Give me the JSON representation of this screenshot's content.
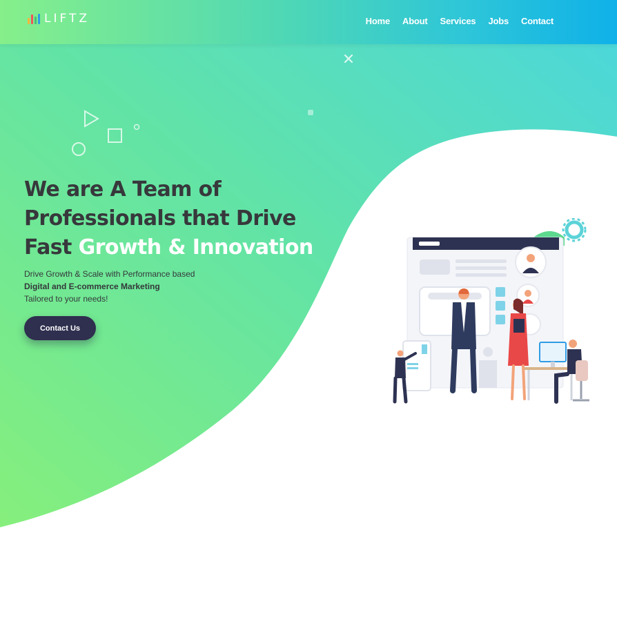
{
  "brand": {
    "name": "LIFTZ",
    "logo_icon": "bar-chart-icon",
    "logo_bar_colors": [
      "#f6b73c",
      "#f2555a",
      "#44c07a",
      "#2e9ce6"
    ]
  },
  "nav": {
    "items": [
      "Home",
      "About",
      "Services",
      "Jobs",
      "Contact"
    ]
  },
  "hero": {
    "headline_part1": "We are A Team of Professionals that Drive Fast",
    "headline_accent": "Growth & Innovation",
    "sub_line1": "Drive Growth & Scale with Performance based",
    "sub_line2": "Digital and E-commerce Marketing",
    "sub_line3": "Tailored to your needs!",
    "cta_label": "Contact Us"
  },
  "decorations": [
    "play-outline-icon",
    "square-outline-icon",
    "circle-outline-icon",
    "dot-icon",
    "close-x-icon",
    "gear-icon"
  ],
  "illustration": "team-business-illustration",
  "colors": {
    "gradient_start": "#86ef7c",
    "gradient_end": "#4ed8dc",
    "text_dark": "#37383c",
    "cta_bg": "#2f2f4f",
    "white": "#ffffff"
  }
}
